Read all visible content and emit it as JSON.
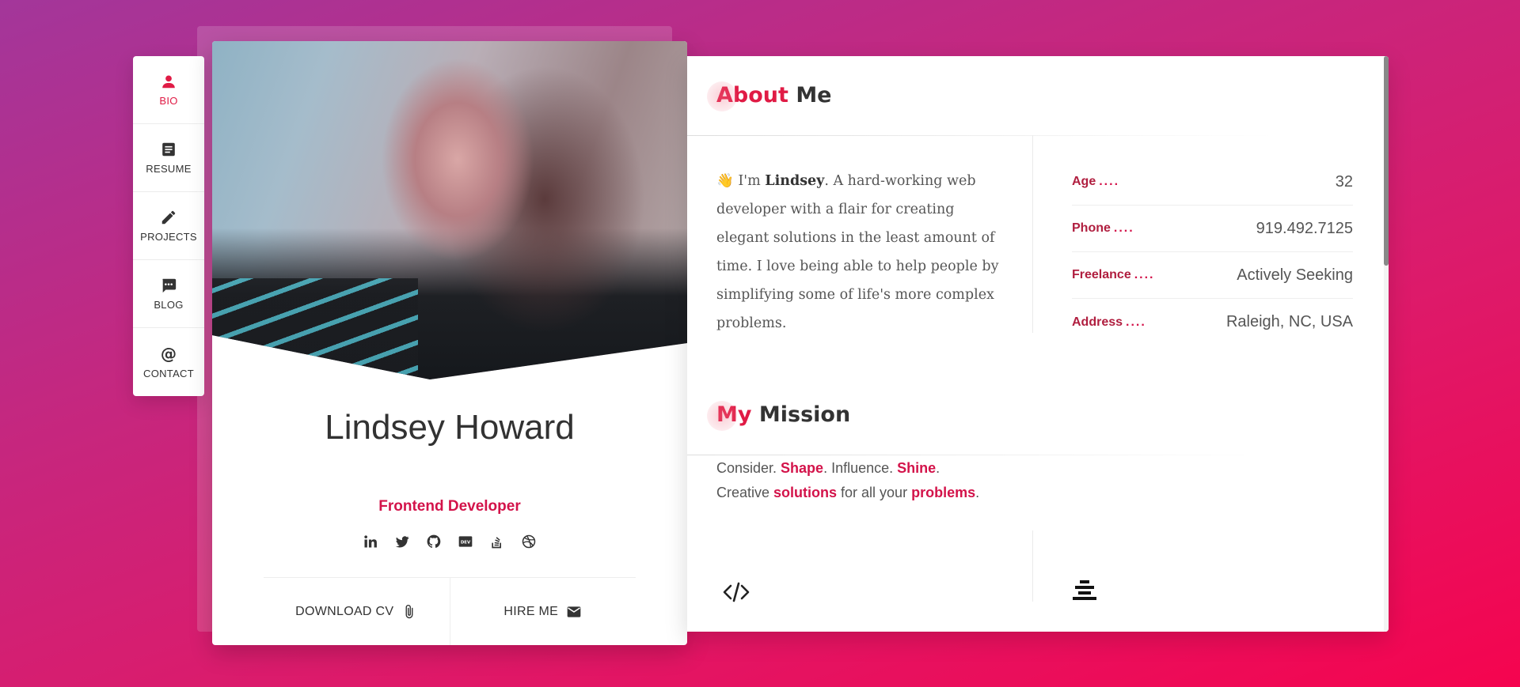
{
  "nav": {
    "items": [
      {
        "label": "BIO",
        "icon": "person-icon",
        "active": true
      },
      {
        "label": "RESUME",
        "icon": "document-icon",
        "active": false
      },
      {
        "label": "PROJECTS",
        "icon": "pencil-icon",
        "active": false
      },
      {
        "label": "BLOG",
        "icon": "chat-icon",
        "active": false
      },
      {
        "label": "CONTACT",
        "icon": "at-icon",
        "active": false
      }
    ]
  },
  "profile": {
    "name": "Lindsey Howard",
    "role": "Frontend Developer",
    "socials": [
      "linkedin-icon",
      "twitter-icon",
      "github-icon",
      "dev-icon",
      "stackoverflow-icon",
      "dribbble-icon"
    ],
    "dev_badge": "DEV",
    "download_label": "DOWNLOAD CV",
    "hire_label": "HIRE ME"
  },
  "about": {
    "title_highlight": "About",
    "title_rest": "Me",
    "wave": "👋",
    "intro": "I'm",
    "name": "Lindsey",
    "text": ". A hard-working web developer with a flair for creating elegant solutions in the least amount of time. I love being able to help people by simplifying some of life's more complex problems.",
    "info": [
      {
        "key": "Age",
        "dots": "....",
        "value": "32"
      },
      {
        "key": "Phone",
        "dots": "....",
        "value": "919.492.7125"
      },
      {
        "key": "Freelance",
        "dots": "....",
        "value": "Actively Seeking"
      },
      {
        "key": "Address",
        "dots": "....",
        "value": "Raleigh, NC, USA"
      }
    ]
  },
  "mission": {
    "title_highlight": "My",
    "title_rest": "Mission",
    "line1": [
      "Consider. ",
      "Shape",
      ". Influence. ",
      "Shine",
      "."
    ],
    "line2": [
      "Creative ",
      "solutions",
      " for all your ",
      "problems",
      "."
    ]
  },
  "colors": {
    "accent": "#e01b45",
    "accent_dark": "#d3134a"
  }
}
